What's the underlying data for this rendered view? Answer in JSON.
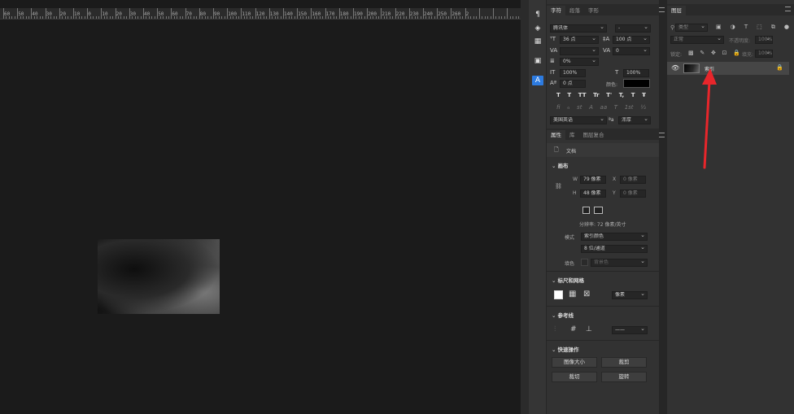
{
  "ruler": {
    "labels": [
      "60",
      "50",
      "40",
      "30",
      "20",
      "10",
      "0",
      "10",
      "20",
      "30",
      "40",
      "50",
      "60",
      "70",
      "80",
      "90",
      "100",
      "110",
      "120",
      "130",
      "140",
      "150",
      "160",
      "170",
      "180",
      "190",
      "200",
      "210",
      "220",
      "230",
      "240",
      "250",
      "260",
      "2"
    ]
  },
  "toolstrip": {
    "icons": [
      "paragraph-styles-icon",
      "3d-icon",
      "table-icon",
      "stamp-icon",
      "character-panel-icon"
    ]
  },
  "character": {
    "tabs": [
      "字符",
      "段落",
      "字形"
    ],
    "font_family": "腾讯体",
    "font_style": "-",
    "font_size": "36 点",
    "leading": "100 点",
    "kerning": "",
    "tracking": "0",
    "scale_ratio": "0%",
    "vertical_scale": "100%",
    "horizontal_scale": "100%",
    "baseline_shift": "0 点",
    "color_label": "颜色:",
    "type_buttons": [
      "T",
      "T",
      "TT",
      "Tr",
      "T'",
      "T,",
      "T",
      "Ŧ"
    ],
    "opentype_buttons": [
      "fi",
      "ℴ",
      "st",
      "A",
      "aa",
      "T",
      "1st",
      "½"
    ],
    "language": "美国英语",
    "aa_label": "ªa",
    "anti_alias": "浑厚"
  },
  "properties": {
    "tabs": [
      "属性",
      "库",
      "图层复合"
    ],
    "doc_label": "文档",
    "canvas_section": "画布",
    "w_label": "W",
    "w_value": "79 像素",
    "x_label": "X",
    "x_value": "0 像素",
    "h_label": "H",
    "h_value": "48 像素",
    "y_label": "Y",
    "y_value": "0 像素",
    "resolution": "分辨率: 72 像素/英寸",
    "mode_label": "模式",
    "mode_value": "索引颜色",
    "depth_value": "8 位/通道",
    "fill_label": "填色",
    "fill_value": "背景色",
    "rulers_section": "标尺和网格",
    "unit_value": "像素",
    "guides_section": "参考线",
    "quick_section": "快速操作",
    "quick_buttons": [
      "图像大小",
      "裁剪",
      "裁切",
      "旋转"
    ]
  },
  "layers": {
    "tab": "图层",
    "filter_kind": "类型",
    "blend_mode": "正常",
    "opacity_label": "不透明度:",
    "opacity_value": "100%",
    "lock_label": "锁定:",
    "fill_label": "填充:",
    "fill_value": "100%",
    "layer_name": "索引"
  },
  "colors": {
    "arrow": "#e8262b",
    "accent": "#2d7be0"
  }
}
